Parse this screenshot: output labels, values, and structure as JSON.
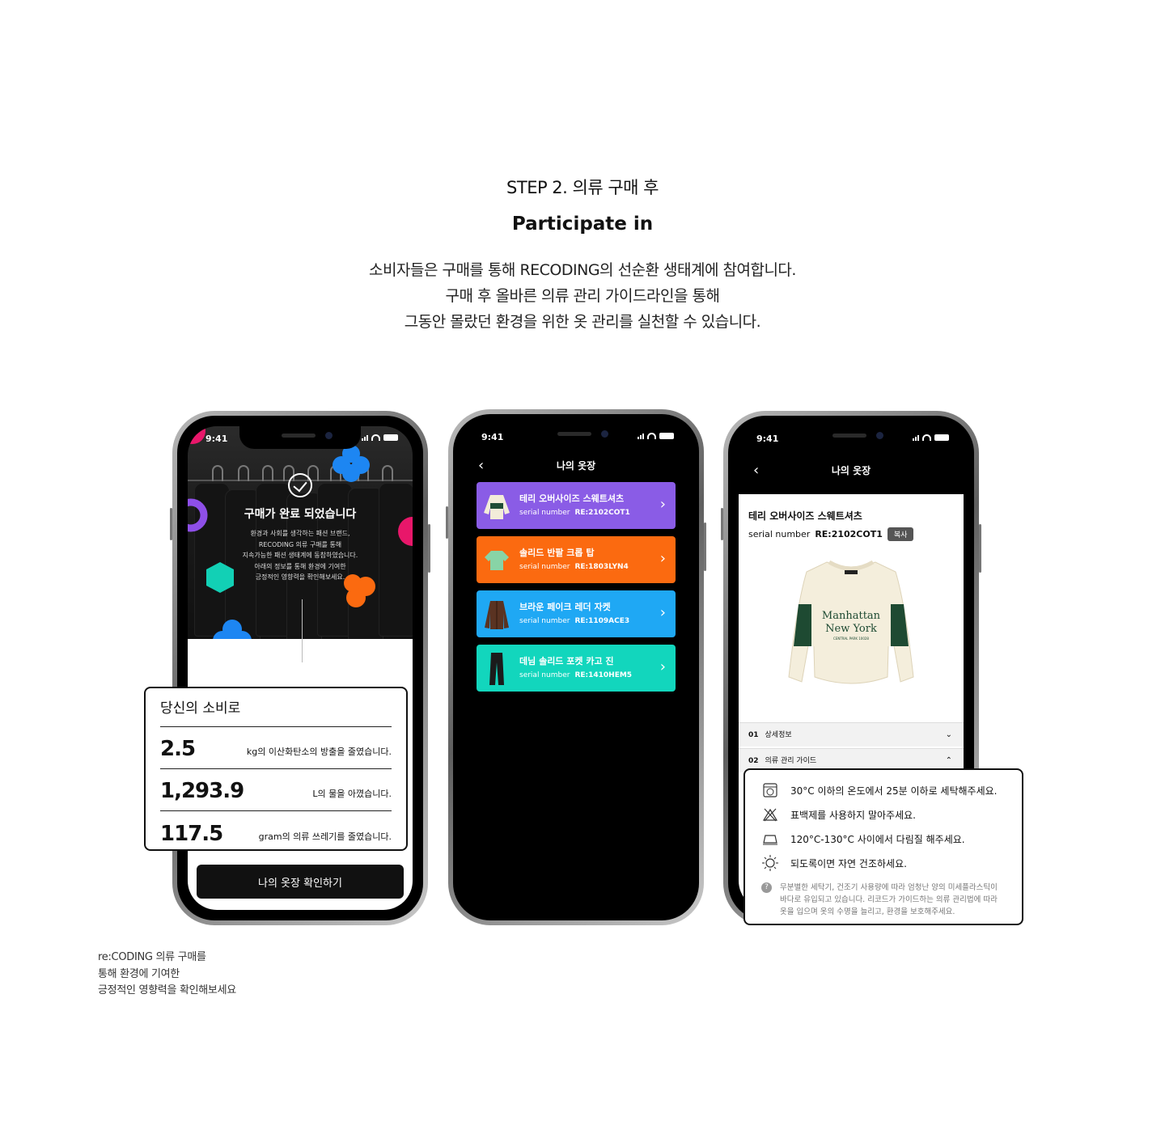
{
  "section": {
    "step": "STEP 2. 의류 구매 후",
    "headline": "Participate in",
    "description": [
      "소비자들은 구매를 통해 RECODING의 선순환 생태계에 참여합니다.",
      "구매 후 올바른 의류 관리 가이드라인을 통해",
      "그동안 몰랐던 환경을 위한 옷 관리를 실천할 수 있습니다."
    ]
  },
  "status_time": "9:41",
  "phone1": {
    "title": "구매가 완료 되었습니다",
    "lines": [
      "환경과 사회를 생각하는 패션 브랜드,",
      "RECODING 의류 구매를 통해",
      "지속가능한 패션 생태계에 동참하였습니다.",
      "아래의 정보를 통해 환경에 기여한",
      "긍정적인 영향력을 확인해보세요."
    ],
    "button": "나의 옷장 확인하기"
  },
  "impact_card": {
    "heading": "당신의 소비로",
    "rows": [
      {
        "value": "2.5",
        "label": "kg의 이산화탄소의 방출을 줄였습니다."
      },
      {
        "value": "1,293.9",
        "label": "L의 물을 아꼈습니다."
      },
      {
        "value": "117.5",
        "label": "gram의 의류 쓰레기를 줄였습니다."
      }
    ]
  },
  "phone2": {
    "header": "나의 옷장",
    "items": [
      {
        "name": "테리 오버사이즈 스웨트셔츠",
        "serial_label": "serial number",
        "serial": "RE:2102COT1",
        "color": "#8a5ce6",
        "thumb": "sweatshirt"
      },
      {
        "name": "솔리드 반팔 크롭 탑",
        "serial_label": "serial number",
        "serial": "RE:1803LYN4",
        "color": "#fb6a10",
        "thumb": "tshirt"
      },
      {
        "name": "브라운 페이크 레더 자켓",
        "serial_label": "serial number",
        "serial": "RE:1109ACE3",
        "color": "#1fa8f4",
        "thumb": "jacket"
      },
      {
        "name": "데님 솔리드 포켓 카고 진",
        "serial_label": "serial number",
        "serial": "RE:1410HEM5",
        "color": "#12d6bd",
        "thumb": "pants"
      }
    ]
  },
  "phone3": {
    "header": "나의 옷장",
    "product_name": "테리 오버사이즈 스웨트셔츠",
    "serial_label": "serial number",
    "serial": "RE:2102COT1",
    "copy_button": "복사",
    "sweatshirt_text": [
      "Manhattan",
      "New York",
      "CENTRAL PARK 10028"
    ],
    "accordion": [
      {
        "num": "01",
        "label": "상세정보",
        "state": "collapsed"
      },
      {
        "num": "02",
        "label": "의류 관리 가이드",
        "state": "expanded"
      }
    ]
  },
  "care_card": {
    "rows": [
      {
        "icon": "wash-30-icon",
        "text": "30°C 이하의 온도에서 25분 이하로 세탁해주세요."
      },
      {
        "icon": "no-bleach-icon",
        "text": "표백제를 사용하지 말아주세요."
      },
      {
        "icon": "iron-icon",
        "text": "120°C-130°C 사이에서 다림질 해주세요."
      },
      {
        "icon": "sun-dry-icon",
        "text": "되도록이면 자연 건조하세요."
      }
    ],
    "note_icon": "?",
    "note": [
      "무분별한 세탁기, 건조기 사용량에 따라 엄청난 양의 미세플라스틱이",
      "바다로 유입되고 있습니다. 리코드가 가이드하는 의류 관리법에 따라",
      "옷을 입으며 옷의 수명을 늘리고, 환경을 보호해주세요."
    ]
  },
  "footnote": [
    "re:CODING 의류 구매를",
    "통해 환경에 기여한",
    "긍정적인 영향력을 확인해보세요"
  ]
}
